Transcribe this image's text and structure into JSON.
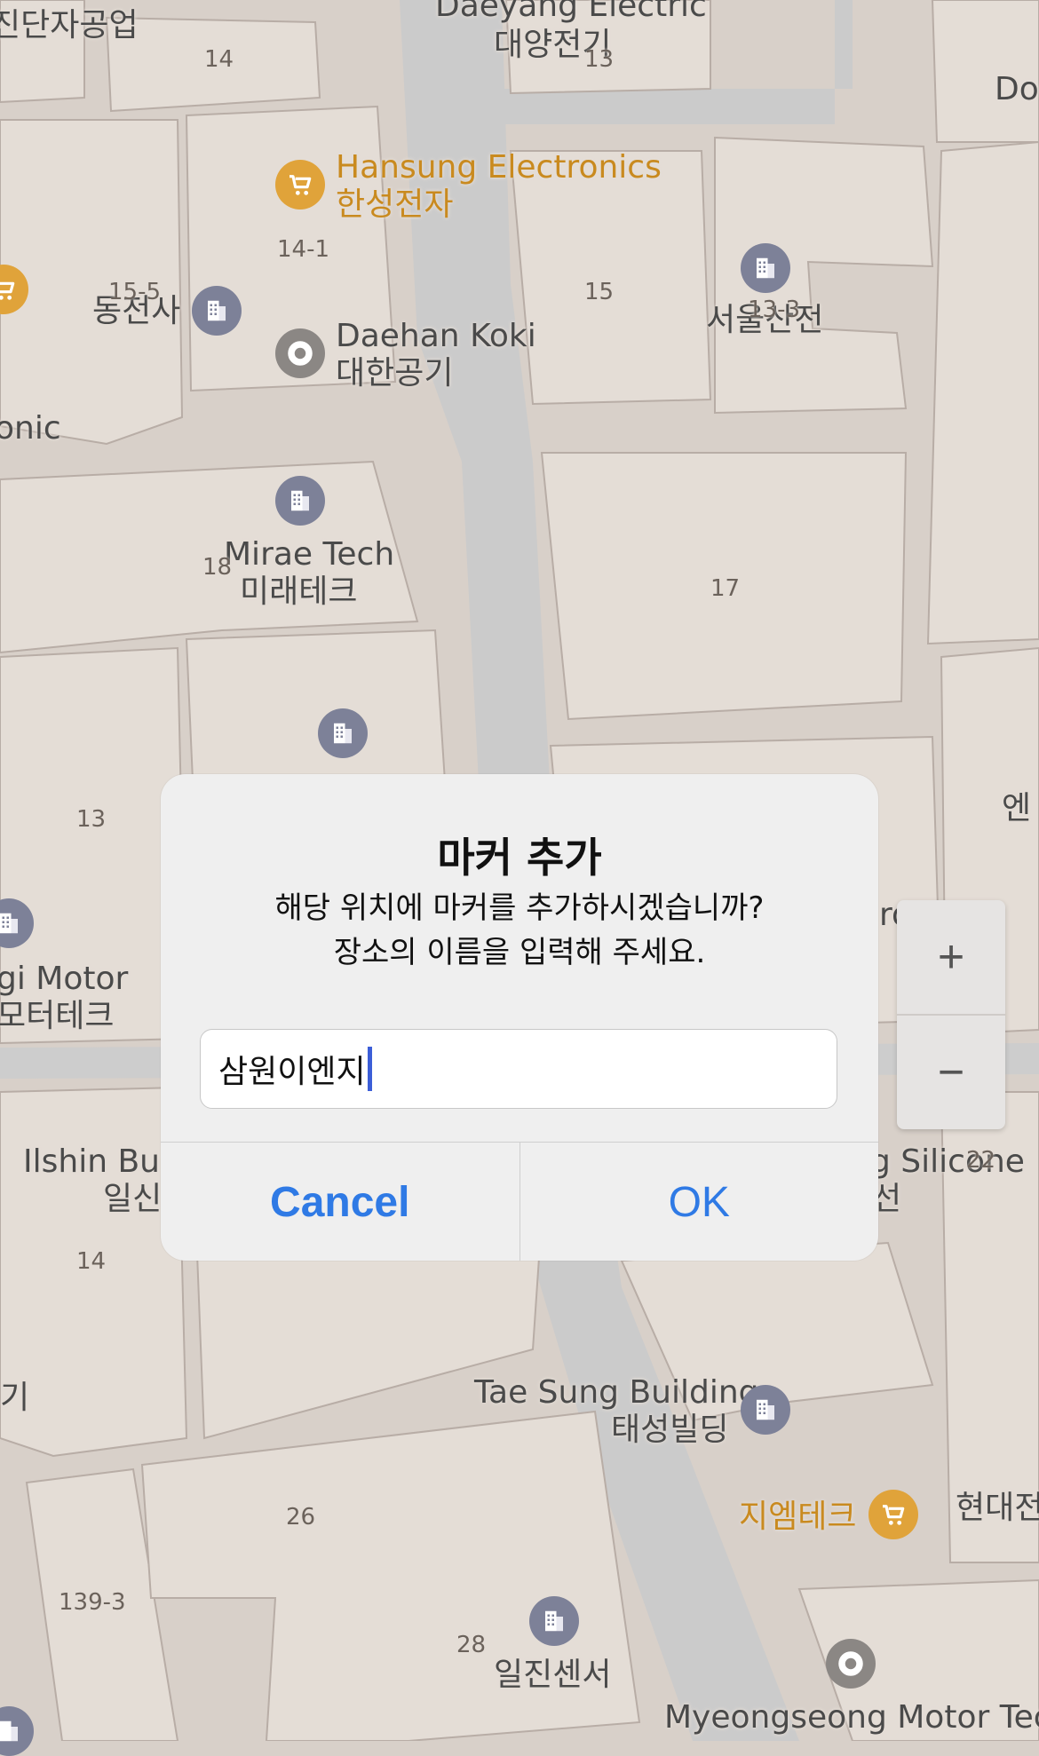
{
  "map": {
    "labels": [
      {
        "id": "lbl-jindanja",
        "text": "진단자공업"
      },
      {
        "id": "lbl-daeyang-en",
        "text": "Daeyang Electric"
      },
      {
        "id": "lbl-daeyang-ko",
        "text": "대양전기"
      },
      {
        "id": "lbl-do",
        "text": "Do"
      },
      {
        "id": "lbl-hansung-en",
        "text": "Hansung Electronics"
      },
      {
        "id": "lbl-hansung-ko",
        "text": "한성전자"
      },
      {
        "id": "lbl-dongjeon",
        "text": "동전사"
      },
      {
        "id": "lbl-daehan-en",
        "text": "Daehan Koki"
      },
      {
        "id": "lbl-daehan-ko",
        "text": "대한공기"
      },
      {
        "id": "lbl-seoulsan",
        "text": "서울산전"
      },
      {
        "id": "lbl-onic",
        "text": "onic"
      },
      {
        "id": "lbl-mirae-en",
        "text": "Mirae Tech"
      },
      {
        "id": "lbl-mirae-ko",
        "text": "미래테크"
      },
      {
        "id": "lbl-en",
        "text": "엔"
      },
      {
        "id": "lbl-gimotor-en",
        "text": "gi Motor"
      },
      {
        "id": "lbl-gimotor-ko",
        "text": "모터테크"
      },
      {
        "id": "lbl-ilshin-en",
        "text": "Ilshin Buil"
      },
      {
        "id": "lbl-ilshin-ko",
        "text": "일신"
      },
      {
        "id": "lbl-silicone-en",
        "text": "g Silicone"
      },
      {
        "id": "lbl-silicone-ko",
        "text": "선"
      },
      {
        "id": "lbl-ro",
        "text": "ro"
      },
      {
        "id": "lbl-gi",
        "text": "기"
      },
      {
        "id": "lbl-taesung-en",
        "text": "Tae Sung Building"
      },
      {
        "id": "lbl-taesung-ko",
        "text": "태성빌딩"
      },
      {
        "id": "lbl-jiem",
        "text": "지엠테크"
      },
      {
        "id": "lbl-hyundae",
        "text": "현대전"
      },
      {
        "id": "lbl-iljin",
        "text": "일진센서"
      },
      {
        "id": "lbl-myeongseong",
        "text": "Myeongseong Motor Tech"
      }
    ],
    "lot_numbers": [
      "14",
      "13",
      "14-1",
      "15-5",
      "15",
      "13-3",
      "18",
      "17",
      "13",
      "22",
      "14",
      "26",
      "139-3",
      "28"
    ]
  },
  "zoom": {
    "plus": "+",
    "minus": "−"
  },
  "dialog": {
    "title": "마커 추가",
    "message_line1": "해당 위치에 마커를 추가하시겠습니까?",
    "message_line2": "장소의 이름을 입력해 주세요.",
    "input_value": "삼원이엔지",
    "cancel": "Cancel",
    "ok": "OK"
  },
  "colors": {
    "map_bg": "#d8d0c9",
    "block": "#e4ddd6",
    "road": "#cdcdcd",
    "accent_orange": "#c98a1f",
    "button_blue": "#2f7ae5"
  }
}
